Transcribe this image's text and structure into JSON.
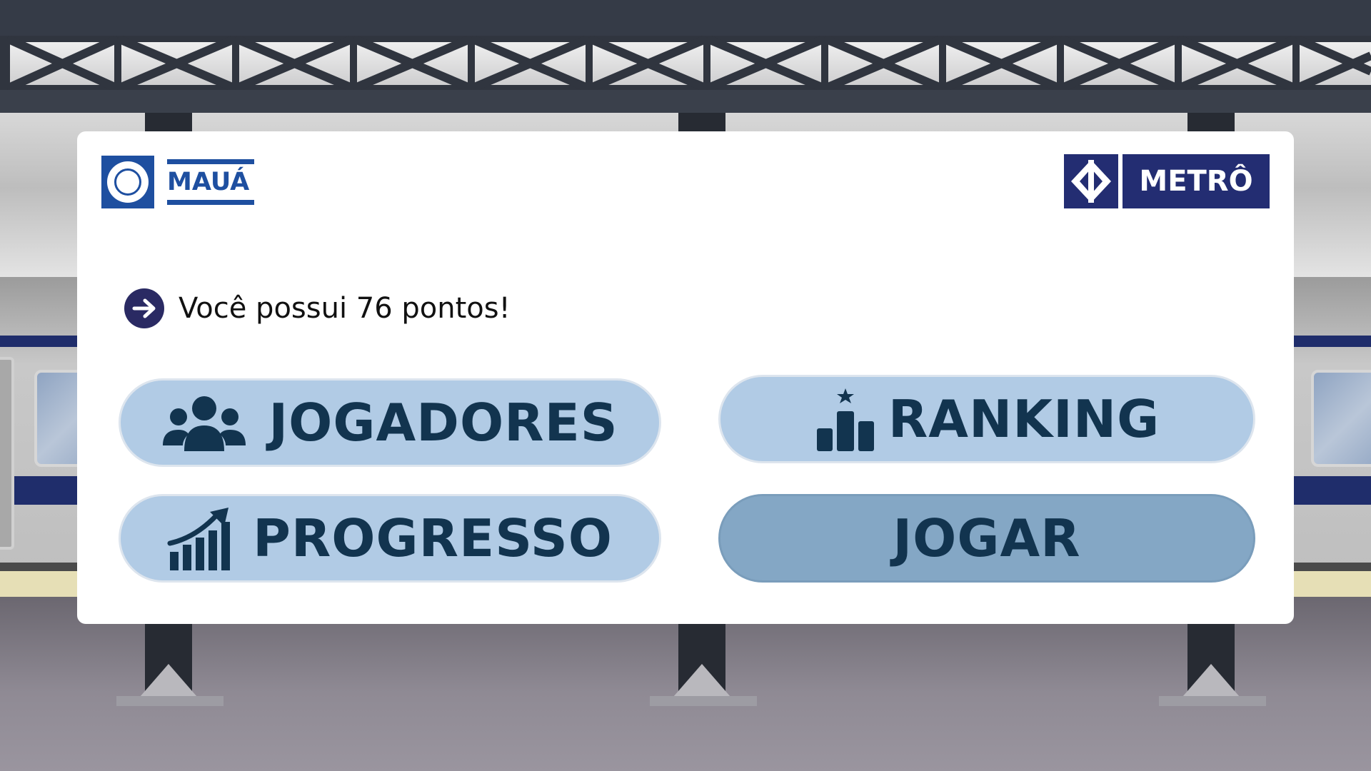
{
  "logos": {
    "maua": {
      "text": "MAUÁ",
      "color": "#1e4fa0"
    },
    "metro": {
      "text": "METRÔ",
      "color": "#232d72"
    }
  },
  "points": {
    "icon": "arrow-right-icon",
    "text": "Você possui 76 pontos!",
    "value": 76
  },
  "menu": {
    "players": {
      "label": "JOGADORES",
      "icon": "users-icon"
    },
    "ranking": {
      "label": "RANKING",
      "icon": "podium-icon"
    },
    "progress": {
      "label": "PROGRESSO",
      "icon": "chart-growth-icon"
    },
    "play": {
      "label": "JOGAR"
    }
  },
  "colors": {
    "button_light": "#b1cbe5",
    "button_dark": "#84a7c5",
    "button_text": "#12344f",
    "background_floor": "#8f8a94"
  }
}
